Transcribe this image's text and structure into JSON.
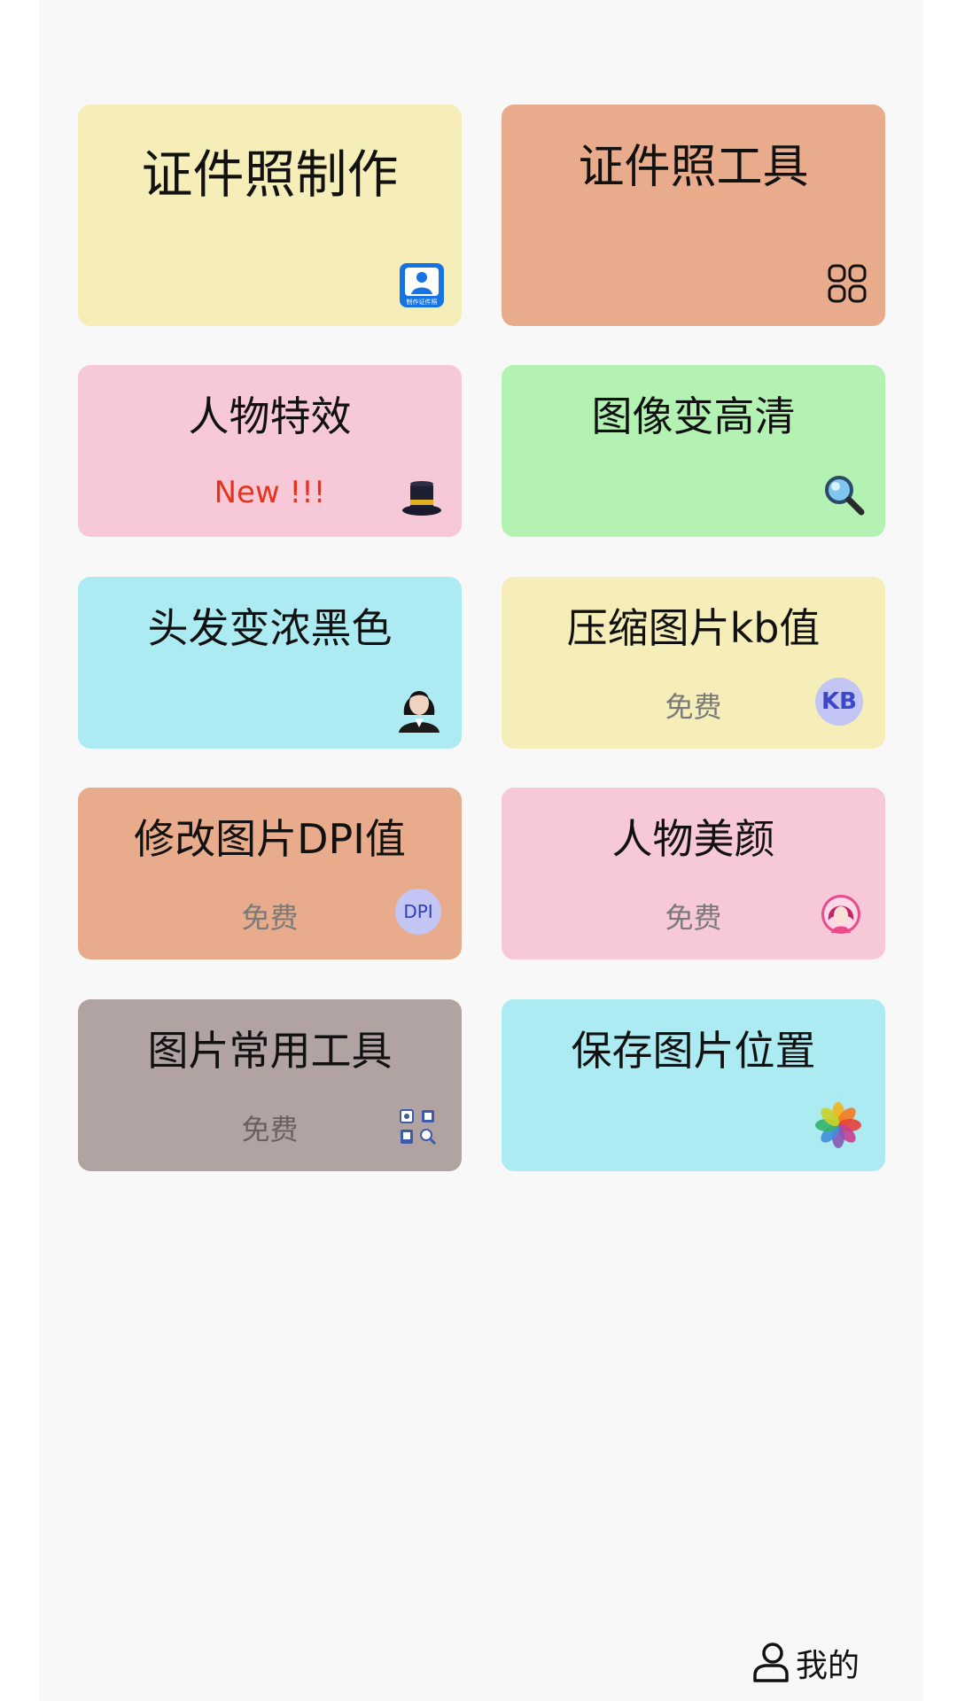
{
  "colors": {
    "yellow": "#f6eeb8",
    "salmon": "#e8ab8c",
    "pink": "#f7c8d8",
    "green": "#b3f2b3",
    "cyan": "#acebf1",
    "taupe": "#b1a3a2",
    "new_red": "#e8331c",
    "free_gray": "#7a7a7a"
  },
  "cards": [
    {
      "title": "证件照制作",
      "sub": "",
      "icon": "id-photo-app-icon",
      "icon_text": "制作证件照"
    },
    {
      "title": "证件照工具",
      "sub": "",
      "icon": "grid-apps-icon"
    },
    {
      "title": "人物特效",
      "sub": "New !!!",
      "icon": "magic-hat-icon"
    },
    {
      "title": "图像变高清",
      "sub": "",
      "icon": "magnifier-icon"
    },
    {
      "title": "头发变浓黑色",
      "sub": "",
      "icon": "portrait-woman-icon"
    },
    {
      "title": "压缩图片kb值",
      "sub": "免费",
      "icon": "kb-badge-icon",
      "icon_text": "KB"
    },
    {
      "title": "修改图片DPI值",
      "sub": "免费",
      "icon": "dpi-badge-icon",
      "icon_text": "DPI"
    },
    {
      "title": "人物美颜",
      "sub": "免费",
      "icon": "beauty-face-icon"
    },
    {
      "title": "图片常用工具",
      "sub": "免费",
      "icon": "image-tools-icon"
    },
    {
      "title": "保存图片位置",
      "sub": "",
      "icon": "photos-flower-icon"
    }
  ],
  "nav": {
    "me_label": "我的",
    "icon": "user-icon"
  }
}
